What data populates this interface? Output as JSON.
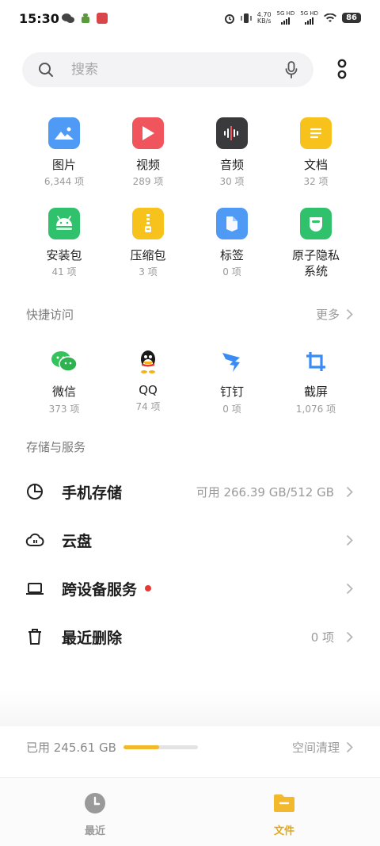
{
  "status_bar": {
    "time": "15:30",
    "net_speed_value": "4.70",
    "net_speed_unit": "KB/s",
    "sim1_tag": "5G HD",
    "sim2_tag": "5G HD",
    "battery": "86"
  },
  "search": {
    "placeholder": "搜索"
  },
  "categories": [
    {
      "label": "图片",
      "count": "6,344 项",
      "icon": "image-icon",
      "color": "#4f9af5"
    },
    {
      "label": "视频",
      "count": "289 项",
      "icon": "video-icon",
      "color": "#f0545c"
    },
    {
      "label": "音频",
      "count": "30 项",
      "icon": "audio-icon",
      "color": "#3a3a3c"
    },
    {
      "label": "文档",
      "count": "32 项",
      "icon": "document-icon",
      "color": "#f7c21b"
    },
    {
      "label": "安装包",
      "count": "41 项",
      "icon": "android-icon",
      "color": "#2fc16b"
    },
    {
      "label": "压缩包",
      "count": "3 项",
      "icon": "archive-icon",
      "color": "#f7c21b"
    },
    {
      "label": "标签",
      "count": "0 项",
      "icon": "tag-icon",
      "color": "#4f9af5"
    },
    {
      "label": "原子隐私",
      "label2": "系统",
      "icon": "privacy-icon",
      "color": "#2fc16b"
    }
  ],
  "quick_access": {
    "title": "快捷访问",
    "more": "更多",
    "items": [
      {
        "label": "微信",
        "count": "373 项",
        "icon": "wechat-icon"
      },
      {
        "label": "QQ",
        "count": "74 项",
        "icon": "qq-icon"
      },
      {
        "label": "钉钉",
        "count": "0 项",
        "icon": "dingtalk-icon"
      },
      {
        "label": "截屏",
        "count": "1,076 项",
        "icon": "crop-icon"
      }
    ]
  },
  "storage": {
    "title": "存储与服务",
    "rows": [
      {
        "label": "手机存储",
        "value": "可用 266.39 GB/512 GB",
        "icon": "pie-chart-icon"
      },
      {
        "label": "云盘",
        "value": "",
        "icon": "cloud-icon"
      },
      {
        "label": "跨设备服务",
        "value": "",
        "icon": "laptop-icon"
      },
      {
        "label": "最近删除",
        "value": "0 项",
        "icon": "trash-icon"
      }
    ]
  },
  "usage": {
    "used": "已用 245.61 GB",
    "fraction": 0.48,
    "clean": "空间清理"
  },
  "tabs": [
    {
      "label": "最近",
      "icon": "clock-icon",
      "active": false
    },
    {
      "label": "文件",
      "icon": "folder-icon",
      "active": true
    }
  ],
  "colors": {
    "accent": "#f1b92b",
    "inactive": "#9a9a9a",
    "badge": "#e53935"
  }
}
